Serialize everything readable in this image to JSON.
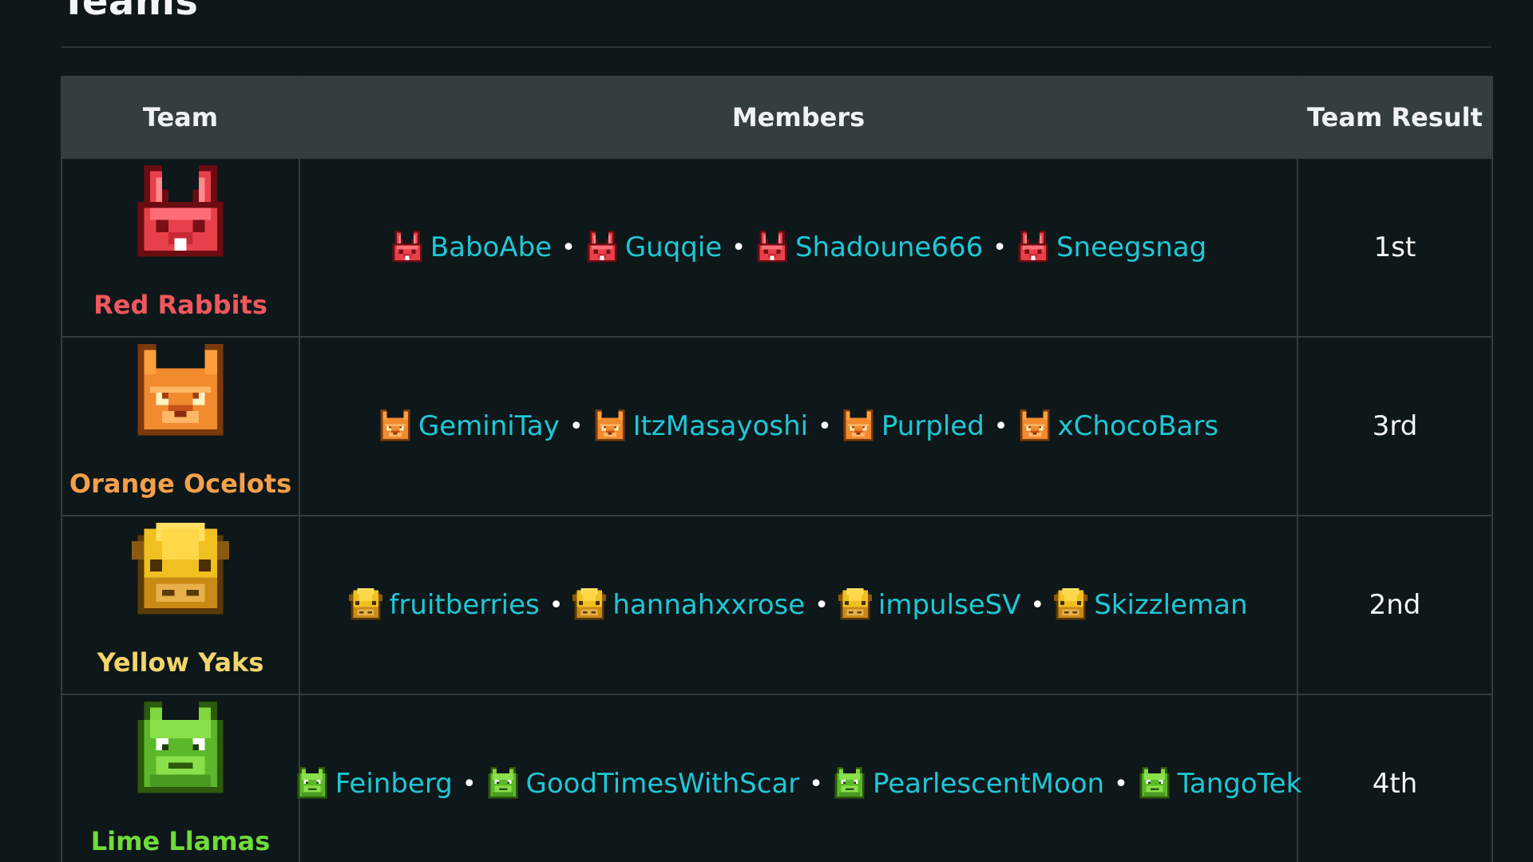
{
  "section": {
    "title": "Teams"
  },
  "table": {
    "headers": {
      "team": "Team",
      "members": "Members",
      "result": "Team Result"
    },
    "rows": [
      {
        "team": "Red Rabbits",
        "team_color": "#f0575e",
        "icon": "red-rabbit-icon",
        "members": [
          "BaboAbe",
          "Guqqie",
          "Shadoune666",
          "Sneegsnag"
        ],
        "result": "1st"
      },
      {
        "team": "Orange Ocelots",
        "team_color": "#f5a04a",
        "icon": "orange-ocelot-icon",
        "members": [
          "GeminiTay",
          "ItzMasayoshi",
          "Purpled",
          "xChocoBars"
        ],
        "result": "3rd"
      },
      {
        "team": "Yellow Yaks",
        "team_color": "#f2d56b",
        "icon": "yellow-yak-icon",
        "members": [
          "fruitberries",
          "hannahxxrose",
          "impulseSV",
          "Skizzleman"
        ],
        "result": "2nd"
      },
      {
        "team": "Lime Llamas",
        "team_color": "#6fdc3a",
        "icon": "lime-llama-icon",
        "members": [
          "Feinberg",
          "GoodTimesWithScar",
          "PearlescentMoon",
          "TangoTek"
        ],
        "result": "4th"
      }
    ]
  },
  "colors": {
    "member_link": "#1ec8d6",
    "background": "#0e1719",
    "header_bg": "#343e41"
  }
}
